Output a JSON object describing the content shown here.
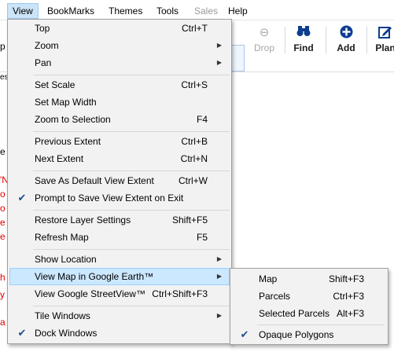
{
  "menubar": {
    "items": [
      {
        "label": "View",
        "open": true
      },
      {
        "label": "BookMarks"
      },
      {
        "label": "Themes"
      },
      {
        "label": "Tools"
      },
      {
        "label": "Sales",
        "disabled": true
      },
      {
        "label": "Help"
      }
    ]
  },
  "toolbar": {
    "drop_label": "Drop",
    "find_label": "Find",
    "add_label": "Add",
    "plan_label": "Plan"
  },
  "background": {
    "frag_p": "p",
    "frag_es": "es",
    "frag_e": "e",
    "frag_n": "'N",
    "frag_o1": "o",
    "frag_o2": "o",
    "frag_e2": "e",
    "frag_e3": "e",
    "frag_h": "h",
    "frag_y": "y",
    "frag_a": "a"
  },
  "view_menu": {
    "items": [
      {
        "label": "Top",
        "shortcut": "Ctrl+T"
      },
      {
        "label": "Zoom",
        "submenu": true
      },
      {
        "label": "Pan",
        "submenu": true
      },
      {
        "label": "Set Scale",
        "shortcut": "Ctrl+S"
      },
      {
        "label": "Set Map Width"
      },
      {
        "label": "Zoom to Selection",
        "shortcut": "F4"
      },
      {
        "label": "Previous Extent",
        "shortcut": "Ctrl+B"
      },
      {
        "label": "Next Extent",
        "shortcut": "Ctrl+N"
      },
      {
        "label": "Save As Default View Extent",
        "shortcut": "Ctrl+W"
      },
      {
        "label": "Prompt to Save View Extent on Exit",
        "checked": true
      },
      {
        "label": "Restore Layer Settings",
        "shortcut": "Shift+F5"
      },
      {
        "label": "Refresh Map",
        "shortcut": "F5"
      },
      {
        "label": "Show Location",
        "submenu": true
      },
      {
        "label": "View Map in Google Earth™",
        "submenu": true,
        "highlighted": true
      },
      {
        "label": "View Google StreetView™",
        "shortcut": "Ctrl+Shift+F3"
      },
      {
        "label": "Tile Windows",
        "submenu": true
      },
      {
        "label": "Dock Windows",
        "checked": true
      }
    ]
  },
  "google_earth_submenu": {
    "items": [
      {
        "label": "Map",
        "shortcut": "Shift+F3"
      },
      {
        "label": "Parcels",
        "shortcut": "Ctrl+F3"
      },
      {
        "label": "Selected Parcels",
        "shortcut": "Alt+F3"
      },
      {
        "label": "Opaque Polygons",
        "checked": true
      }
    ]
  },
  "icons": {
    "check": "checkmark-icon",
    "submenu": "submenu-arrow-icon",
    "drop": "drop-icon",
    "find": "binoculars-icon",
    "add": "add-icon",
    "plan": "plan-icon"
  },
  "colors": {
    "highlight": "#cce8ff",
    "highlight_border": "#99d1ff",
    "menu_bg": "#f2f2f2",
    "check": "#1f4e8c",
    "error_text": "#e00000"
  }
}
